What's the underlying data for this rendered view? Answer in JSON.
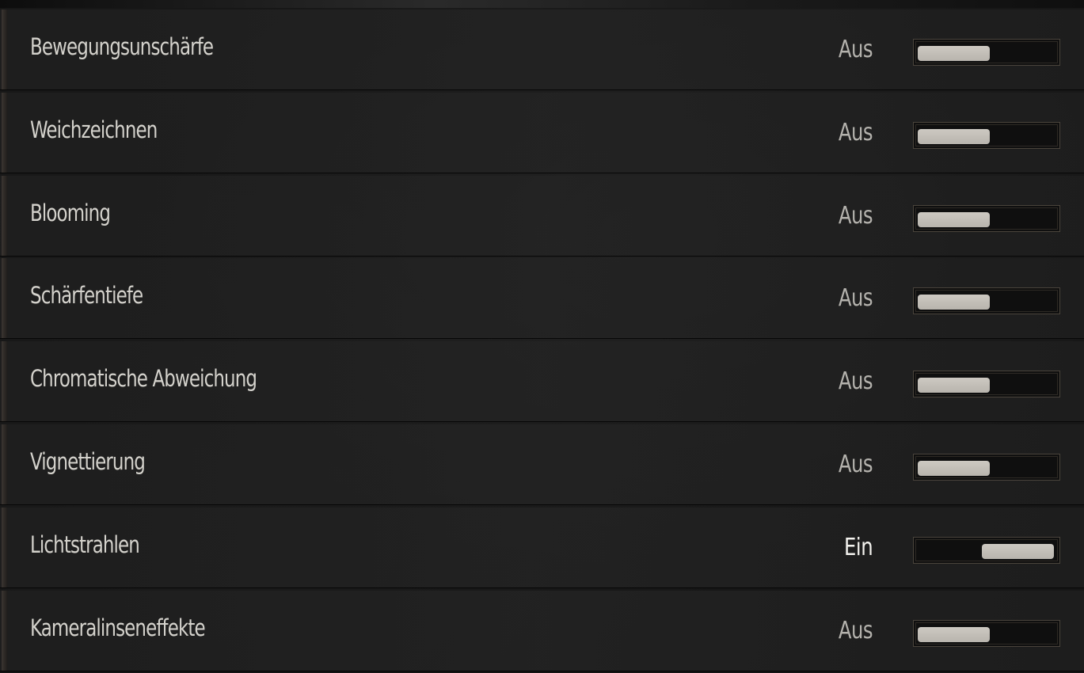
{
  "settings": [
    {
      "label": "Bewegungsunschärfe",
      "value": "Aus",
      "enabled": false
    },
    {
      "label": "Weichzeichnen",
      "value": "Aus",
      "enabled": false
    },
    {
      "label": "Blooming",
      "value": "Aus",
      "enabled": false
    },
    {
      "label": "Schärfentiefe",
      "value": "Aus",
      "enabled": false
    },
    {
      "label": "Chromatische Abweichung",
      "value": "Aus",
      "enabled": false
    },
    {
      "label": "Vignettierung",
      "value": "Aus",
      "enabled": false
    },
    {
      "label": "Lichtstrahlen",
      "value": "Ein",
      "enabled": true
    },
    {
      "label": "Kameralinseneffekte",
      "value": "Aus",
      "enabled": false
    }
  ],
  "colors": {
    "label": "#d4d2cc",
    "value_off": "#b4b2ad",
    "value_on": "#f4f3ef",
    "knob": "#c4c0b9",
    "frame": "#4a443c"
  }
}
